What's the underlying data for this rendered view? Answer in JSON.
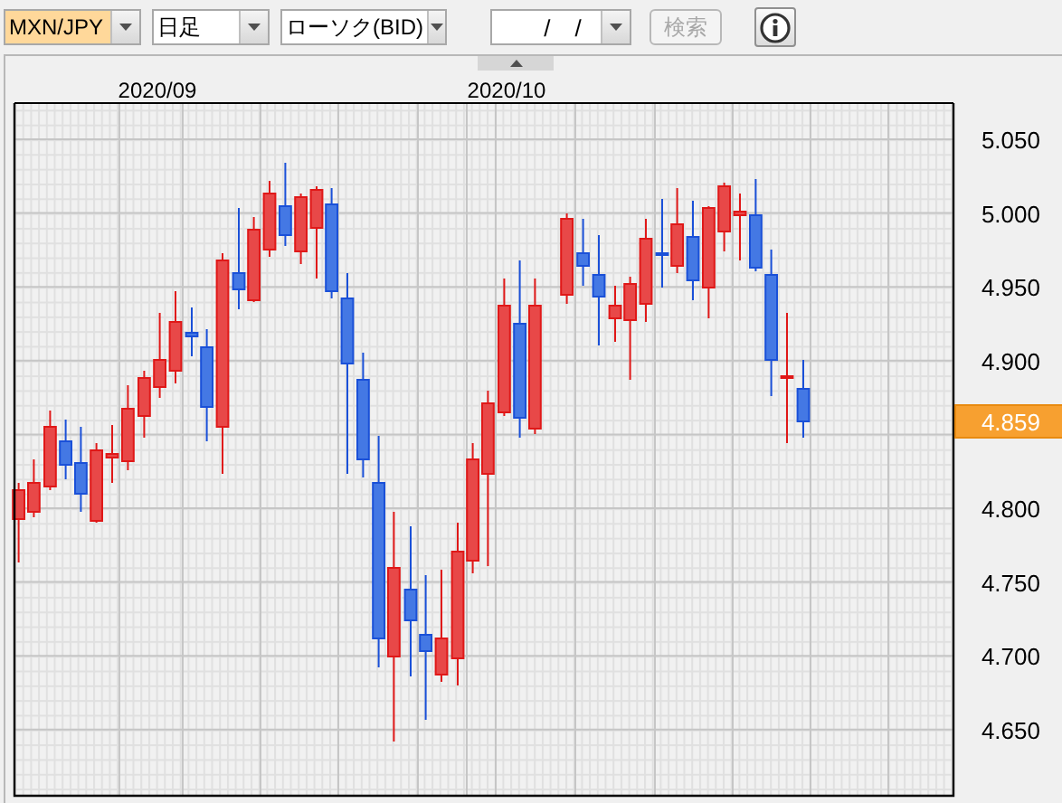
{
  "toolbar": {
    "symbol": {
      "value": "MXN/JPY",
      "highlighted": true
    },
    "period": {
      "value": "日足",
      "highlighted": false
    },
    "chart_type": {
      "value": "ローソク(BID)",
      "highlighted": false
    },
    "date": {
      "value": "/ /"
    },
    "search_button": {
      "label": "検索",
      "disabled": true
    }
  },
  "chart": {
    "date_labels": [
      "2020/09",
      "2020/10"
    ],
    "price_labels_above": [
      "5.050",
      "5.000",
      "4.950",
      "4.900"
    ],
    "price_labels_below": [
      "4.800",
      "4.750",
      "4.700",
      "4.650"
    ],
    "current_price": "4.859"
  }
}
